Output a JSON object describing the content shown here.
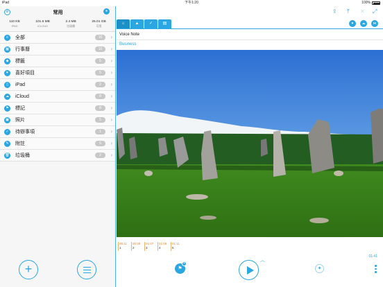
{
  "status": {
    "device": "iPad",
    "time": "下午1:20",
    "battery": "100%"
  },
  "sidebar": {
    "title": "常用",
    "stats": [
      {
        "value": "110 KB",
        "label": "IPAD"
      },
      {
        "value": "101.6 MB",
        "label": "ICLOUD"
      },
      {
        "value": "2.4 MB",
        "label": "垃圾桶"
      },
      {
        "value": "25.01 GB",
        "label": "可用"
      }
    ],
    "items": [
      {
        "label": "全部",
        "count": "10",
        "icon": "all-icon",
        "glyph": "≡"
      },
      {
        "label": "行事曆",
        "count": "10",
        "icon": "calendar-icon",
        "glyph": "▦"
      },
      {
        "label": "標籤",
        "count": "5",
        "icon": "tag-icon",
        "glyph": "◆"
      },
      {
        "label": "喜好項目",
        "count": "5",
        "icon": "heart-icon",
        "glyph": "♥"
      },
      {
        "label": "iPad",
        "count": "2",
        "icon": "ipad-icon",
        "glyph": "▯"
      },
      {
        "label": "iCloud",
        "count": "8",
        "icon": "cloud-icon",
        "glyph": "☁"
      },
      {
        "label": "標記",
        "count": "8",
        "icon": "flag-icon",
        "glyph": "⚑"
      },
      {
        "label": "照片",
        "count": "5",
        "icon": "photo-icon",
        "glyph": "▣"
      },
      {
        "label": "待辦事項",
        "count": "1",
        "icon": "todo-icon",
        "glyph": "✓"
      },
      {
        "label": "附註",
        "count": "5",
        "icon": "note-icon",
        "glyph": "✎"
      },
      {
        "label": "垃圾桶",
        "count": "2",
        "icon": "trash-icon",
        "glyph": "🗑"
      }
    ]
  },
  "main": {
    "note_title": "Voice Note",
    "category": "Business",
    "timeline": [
      {
        "time": "00:11",
        "index": "1"
      },
      {
        "time": "00:39",
        "index": "2"
      },
      {
        "time": "01:07",
        "index": "3"
      },
      {
        "time": "01:08",
        "index": "4"
      },
      {
        "time": "01:11",
        "index": "5"
      }
    ],
    "duration": "01:41"
  },
  "colors": {
    "accent": "#2aa7e2",
    "timeline": "#f08b2a"
  }
}
